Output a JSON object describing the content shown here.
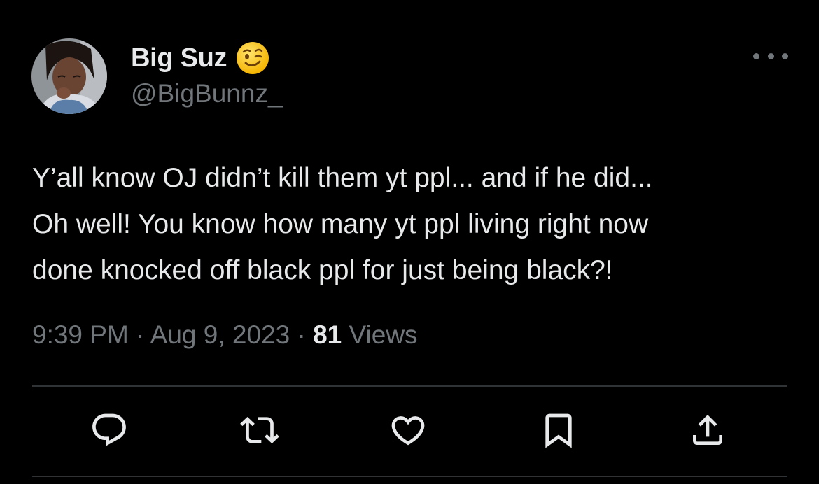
{
  "author": {
    "display_name": "Big Suz",
    "handle": "@BigBunnz_",
    "name_emoji": "winking-face-emoji",
    "avatar": "profile-photo"
  },
  "tweet": {
    "lines": [
      "Y’all know OJ didn’t kill them yt ppl... and if he did...",
      "Oh well! You know how many yt ppl living right now",
      "done knocked off black ppl for just being black?!"
    ]
  },
  "meta": {
    "time": "9:39 PM",
    "separator": "·",
    "date": "Aug 9, 2023",
    "views_count": "81",
    "views_label": "Views"
  },
  "actions": [
    {
      "icon": "reply-icon"
    },
    {
      "icon": "retweet-icon"
    },
    {
      "icon": "like-icon"
    },
    {
      "icon": "bookmark-icon"
    },
    {
      "icon": "share-icon"
    }
  ],
  "colors": {
    "background": "#000000",
    "primary_text": "#e7e9ea",
    "secondary_text": "#71767b",
    "divider": "#2f3336"
  }
}
